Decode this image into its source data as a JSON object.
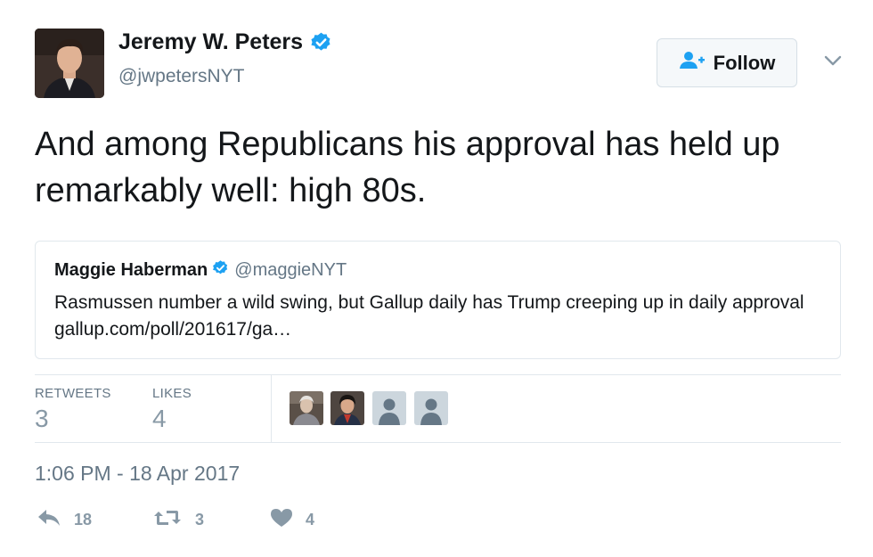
{
  "author": {
    "name": "Jeremy W. Peters",
    "handle": "@jwpetersNYT",
    "avatar_icon": "author-avatar-photo",
    "verified_icon": "verified-badge-icon"
  },
  "follow_button": {
    "label": "Follow",
    "icon": "follow-user-icon"
  },
  "tweet": {
    "text": "And among Republicans his approval has held up remarkably well: high 80s.",
    "timestamp": "1:06 PM - 18 Apr 2017"
  },
  "quoted_tweet": {
    "name": "Maggie Haberman",
    "handle": "@maggieNYT",
    "text": "Rasmussen number a wild swing, but Gallup daily has Trump creeping up in daily approval",
    "link": "gallup.com/poll/201617/ga…"
  },
  "stats": {
    "retweets_label": "RETWEETS",
    "retweets_value": "3",
    "likes_label": "LIKES",
    "likes_value": "4"
  },
  "likers": [
    "liker-avatar-photo",
    "liker-avatar-photo",
    "default-avatar-icon",
    "default-avatar-icon"
  ],
  "actions": {
    "reply_count": "18",
    "retweet_count": "3",
    "like_count": "4"
  },
  "colors": {
    "accent": "#1da1f2",
    "text": "#14171a",
    "secondary": "#657786",
    "muted": "#8899a6",
    "border": "#e1e8ed"
  }
}
